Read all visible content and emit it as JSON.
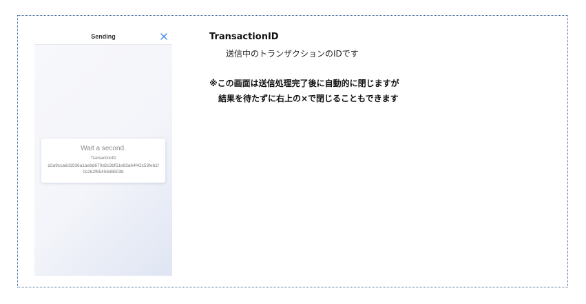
{
  "phone": {
    "title": "Sending",
    "close_icon": "close-icon",
    "card": {
      "wait_text": "Wait a second.",
      "id_label": "TransactionID",
      "id_value": "d2a9cca6d1936a1ae8d670d2c3bf51e83a64f42c53feb1f0c262f65456d8503b"
    }
  },
  "description": {
    "title": "TransactionID",
    "text": "送信中のトランザクションのIDです",
    "note_line1": "※この画面は送信処理完了後に自動的に閉じますが",
    "note_line2": "結果を待たずに右上の×で閉じることもできます"
  },
  "colors": {
    "accent": "#3b82f6",
    "frame_border": "#3f6496"
  }
}
